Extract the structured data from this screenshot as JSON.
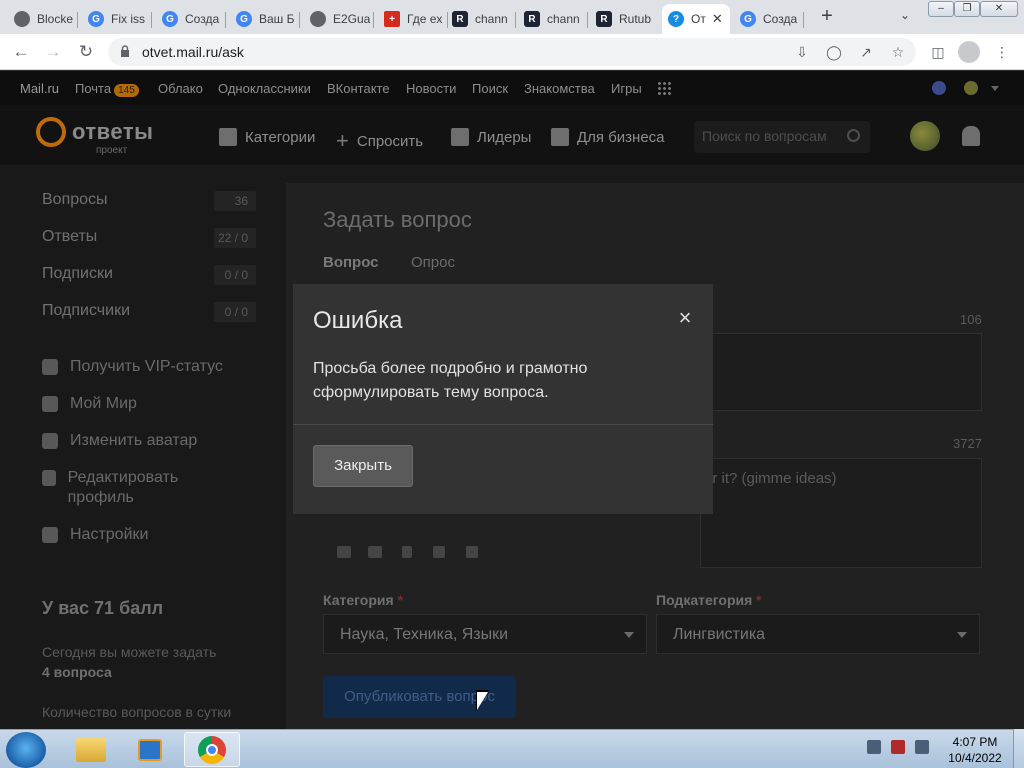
{
  "browser": {
    "tabs": [
      {
        "label": "Blocke",
        "icon": "globe-icon",
        "color": "#5f6368"
      },
      {
        "label": "Fix iss",
        "icon": "google-icon",
        "color": "#4285f4"
      },
      {
        "label": "Созда",
        "icon": "google-icon",
        "color": "#4285f4"
      },
      {
        "label": "Ваш Б",
        "icon": "google-icon",
        "color": "#4285f4"
      },
      {
        "label": "E2Gua",
        "icon": "globe-icon",
        "color": "#5f6368"
      },
      {
        "label": "Где ex",
        "icon": "swiss-flag-icon",
        "color": "#d52b1e"
      },
      {
        "label": "chann",
        "icon": "rutube-icon",
        "color": "#1d2433"
      },
      {
        "label": "chann",
        "icon": "rutube-icon",
        "color": "#1d2433"
      },
      {
        "label": "Rutub",
        "icon": "rutube-icon",
        "color": "#1d2433"
      },
      {
        "label": "От",
        "icon": "otvety-icon",
        "color": "#168de2"
      },
      {
        "label": "Созда",
        "icon": "google-icon",
        "color": "#4285f4"
      }
    ],
    "new_tab": "+",
    "url": "otvet.mail.ru/ask"
  },
  "mailbar": {
    "links": [
      "Mail.ru",
      "Почта",
      "Облако",
      "Одноклассники",
      "ВКонтакте",
      "Новости",
      "Поиск",
      "Знакомства",
      "Игры"
    ],
    "mail_badge": "145"
  },
  "header": {
    "logo_word": "ответы",
    "logo_sub": "проект",
    "nav": [
      "Категории",
      "Спросить",
      "Лидеры",
      "Для бизнеса"
    ],
    "search_placeholder": "Поиск по вопросам"
  },
  "sidebar": {
    "stats": [
      {
        "label": "Вопросы",
        "count": "36"
      },
      {
        "label": "Ответы",
        "count": "22 / 0"
      },
      {
        "label": "Подписки",
        "count": "0 / 0"
      },
      {
        "label": "Подписчики",
        "count": "0 / 0"
      }
    ],
    "links": [
      {
        "label": "Получить VIP-статус",
        "icon": "crown-icon"
      },
      {
        "label": "Мой Мир",
        "icon": "moimir-icon"
      },
      {
        "label": "Изменить аватар",
        "icon": "camera-icon"
      },
      {
        "label": "Редактировать профиль",
        "icon": "pencil-icon"
      },
      {
        "label": "Настройки",
        "icon": "gear-icon"
      }
    ],
    "score": "У вас 71 балл",
    "today_text": "Сегодня вы можете задать",
    "today_count": "4 вопроса",
    "limit_text": "Количество вопросов в сутки"
  },
  "ask_form": {
    "title": "Задать вопрос",
    "tabs": [
      "Вопрос",
      "Опрос"
    ],
    "title_counter": "106",
    "body_counter": "3727",
    "body_text": "or it? (gimme ideas)",
    "category_label": "Категория",
    "category_value": "Наука, Техника, Языки",
    "subcategory_label": "Подкатегория",
    "subcategory_value": "Лингвистика",
    "required_mark": "*",
    "publish_button": "Опубликовать вопрос"
  },
  "modal": {
    "title": "Ошибка",
    "close_glyph": "×",
    "message": "Просьба более подробно и грамотно сформулировать тему вопроса.",
    "button": "Закрыть"
  },
  "taskbar": {
    "time": "4:07 PM",
    "date": "10/4/2022"
  }
}
